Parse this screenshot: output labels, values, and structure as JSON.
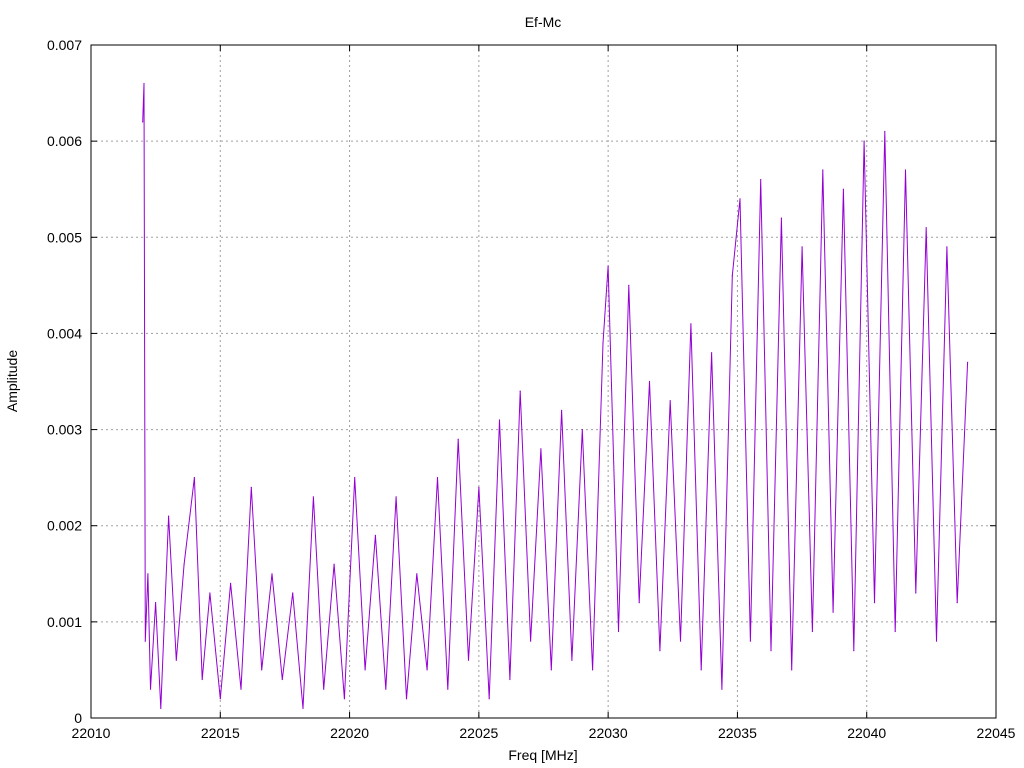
{
  "chart_data": {
    "type": "line",
    "title": "Ef-Mc",
    "xlabel": "Freq [MHz]",
    "ylabel": "Amplitude",
    "xlim": [
      22010,
      22045
    ],
    "ylim": [
      0,
      0.007
    ],
    "xticks": [
      22010,
      22015,
      22020,
      22025,
      22030,
      22035,
      22040,
      22045
    ],
    "xtick_labels": [
      "22010",
      "22015",
      "22020",
      "22025",
      "22030",
      "22035",
      "22040",
      "22045"
    ],
    "yticks": [
      0,
      0.001,
      0.002,
      0.003,
      0.004,
      0.005,
      0.006,
      0.007
    ],
    "ytick_labels": [
      "0",
      "0.001",
      "0.002",
      "0.003",
      "0.004",
      "0.005",
      "0.006",
      "0.007"
    ],
    "grid": true,
    "series": [
      {
        "color": "#9400d3",
        "x": [
          22012.0,
          22012.05,
          22012.1,
          22012.2,
          22012.3,
          22012.5,
          22012.7,
          22013.0,
          22013.3,
          22013.6,
          22014.0,
          22014.3,
          22014.6,
          22015.0,
          22015.4,
          22015.8,
          22016.2,
          22016.6,
          22017.0,
          22017.4,
          22017.8,
          22018.2,
          22018.6,
          22019.0,
          22019.4,
          22019.8,
          22020.2,
          22020.6,
          22021.0,
          22021.4,
          22021.8,
          22022.2,
          22022.6,
          22023.0,
          22023.4,
          22023.8,
          22024.2,
          22024.6,
          22025.0,
          22025.4,
          22025.8,
          22026.2,
          22026.6,
          22027.0,
          22027.4,
          22027.8,
          22028.2,
          22028.6,
          22029.0,
          22029.4,
          22029.8,
          22030.0,
          22030.4,
          22030.8,
          22031.2,
          22031.6,
          22032.0,
          22032.4,
          22032.8,
          22033.2,
          22033.6,
          22034.0,
          22034.4,
          22034.8,
          22035.1,
          22035.5,
          22035.9,
          22036.3,
          22036.7,
          22037.1,
          22037.5,
          22037.9,
          22038.3,
          22038.7,
          22039.1,
          22039.5,
          22039.9,
          22040.3,
          22040.7,
          22041.1,
          22041.5,
          22041.9,
          22042.3,
          22042.7,
          22043.1,
          22043.5,
          22043.9
        ],
        "y": [
          0.0062,
          0.0066,
          0.0008,
          0.0015,
          0.0003,
          0.0012,
          0.0001,
          0.0021,
          0.0006,
          0.0016,
          0.0025,
          0.0004,
          0.0013,
          0.0002,
          0.0014,
          0.0003,
          0.0024,
          0.0005,
          0.0015,
          0.0004,
          0.0013,
          0.0001,
          0.0023,
          0.0003,
          0.0016,
          0.0002,
          0.0025,
          0.0005,
          0.0019,
          0.0003,
          0.0023,
          0.0002,
          0.0015,
          0.0005,
          0.0025,
          0.0003,
          0.0029,
          0.0006,
          0.0024,
          0.0002,
          0.0031,
          0.0004,
          0.0034,
          0.0008,
          0.0028,
          0.0005,
          0.0032,
          0.0006,
          0.003,
          0.0005,
          0.0039,
          0.0047,
          0.0009,
          0.0045,
          0.0012,
          0.0035,
          0.0007,
          0.0033,
          0.0008,
          0.0041,
          0.0005,
          0.0038,
          0.0003,
          0.0046,
          0.0054,
          0.0008,
          0.0056,
          0.0007,
          0.0052,
          0.0005,
          0.0049,
          0.0009,
          0.0057,
          0.0011,
          0.0055,
          0.0007,
          0.006,
          0.0012,
          0.0061,
          0.0009,
          0.0057,
          0.0013,
          0.0051,
          0.0008,
          0.0049,
          0.0012,
          0.0037
        ]
      }
    ]
  }
}
